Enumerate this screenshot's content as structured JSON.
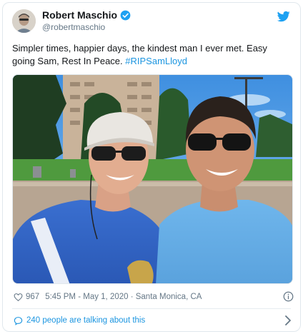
{
  "tweet": {
    "display_name": "Robert Maschio",
    "handle": "@robertmaschio",
    "verified": true,
    "text_main": "Simpler times, happier days, the kindest man I ever met. Easy going Sam, Rest In Peace. ",
    "hashtag": "#RIPSamLloyd",
    "likes": "967",
    "timestamp": "5:45 PM - May 1, 2020 · Santa Monica, CA",
    "talking_about": "240 people are talking about this"
  },
  "icons": {
    "verified": "verified-badge-icon",
    "twitter": "twitter-bird-icon",
    "like": "heart-icon",
    "info": "info-icon",
    "reply": "speech-bubble-icon",
    "more": "chevron-right-icon"
  },
  "colors": {
    "link": "#1b95e0",
    "secondary_text": "#657786",
    "border": "#e1e8ed"
  }
}
